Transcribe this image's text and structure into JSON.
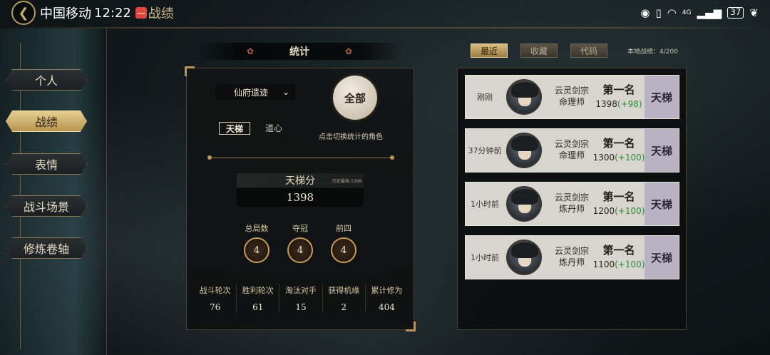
{
  "status_bar": {
    "carrier": "中国移动",
    "time": "12:22",
    "notif_badge": "—",
    "page_title": "战绩",
    "network": "4G",
    "battery": "37"
  },
  "sidebar": {
    "items": [
      {
        "label": "个人"
      },
      {
        "label": "战绩"
      },
      {
        "label": "表情"
      },
      {
        "label": "战斗场景"
      },
      {
        "label": "修炼卷轴"
      }
    ],
    "active_index": 1
  },
  "stats": {
    "header": "统计",
    "dropdown_value": "仙府遗迹",
    "mode_tabs": [
      "天梯",
      "道心"
    ],
    "all_button": "全部",
    "all_hint": "点击切换统计的角色",
    "score_label": "天梯分",
    "score_history": "历史最高:1398",
    "score_value": "1398",
    "badges": [
      {
        "label": "总局数",
        "value": "4"
      },
      {
        "label": "夺冠",
        "value": "4"
      },
      {
        "label": "前四",
        "value": "4"
      }
    ],
    "bottom": [
      {
        "label": "战斗轮次",
        "value": "76"
      },
      {
        "label": "胜利轮次",
        "value": "61"
      },
      {
        "label": "淘汰对手",
        "value": "15"
      },
      {
        "label": "获得机缘",
        "value": "2"
      },
      {
        "label": "累计修为",
        "value": "404"
      }
    ]
  },
  "records": {
    "tabs": [
      "最近",
      "收藏",
      "代码"
    ],
    "active_tab": 0,
    "local_count": "本地战绩：4/200",
    "items": [
      {
        "time": "刚刚",
        "sect": "云灵剑宗",
        "role": "命理师",
        "rank": "第一名",
        "score": "1398",
        "delta": "(+98)",
        "mode": "天梯"
      },
      {
        "time": "37分钟前",
        "sect": "云灵剑宗",
        "role": "命理师",
        "rank": "第一名",
        "score": "1300",
        "delta": "(+100)",
        "mode": "天梯"
      },
      {
        "time": "1小时前",
        "sect": "云灵剑宗",
        "role": "炼丹师",
        "rank": "第一名",
        "score": "1200",
        "delta": "(+100)",
        "mode": "天梯"
      },
      {
        "time": "1小时前",
        "sect": "云灵剑宗",
        "role": "炼丹师",
        "rank": "第一名",
        "score": "1100",
        "delta": "(+100)",
        "mode": "天梯"
      }
    ]
  }
}
